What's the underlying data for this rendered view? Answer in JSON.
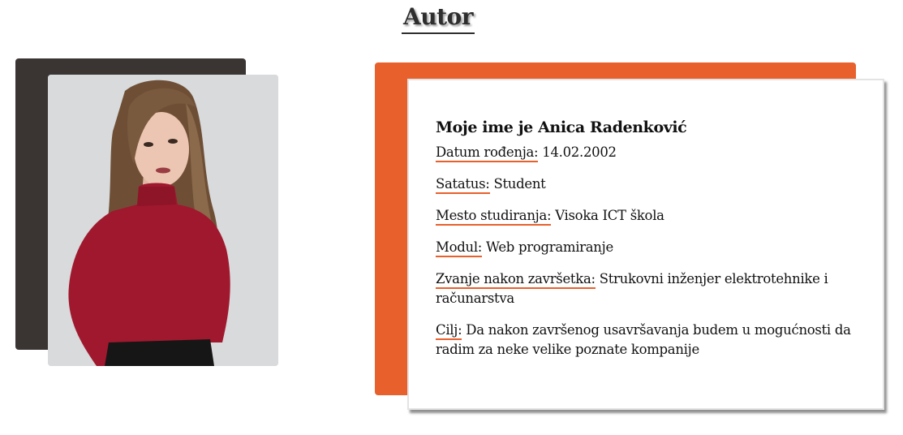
{
  "page": {
    "title": "Autor"
  },
  "author": {
    "heading": "Moje ime je Anica Radenković",
    "fields": [
      {
        "label": "Datum rođenja:",
        "value": " 14.02.2002"
      },
      {
        "label": "Satatus:",
        "value": " Student"
      },
      {
        "label": "Mesto studiranja:",
        "value": " Visoka ICT škola"
      },
      {
        "label": "Modul:",
        "value": " Web programiranje"
      },
      {
        "label": "Zvanje nakon završetka:",
        "value": " Strukovni inženjer elektrotehnike i računarstva"
      },
      {
        "label": "Cilj:",
        "value": " Da nakon završenog usavršavanja budem u mogućnosti da radim za neke velike poznate kompanije"
      }
    ]
  },
  "colors": {
    "accent": "#e8602c",
    "dark_frame": "#3a3533",
    "sweater": "#a0182e"
  },
  "photo": {
    "icon": "author-portrait-image"
  }
}
